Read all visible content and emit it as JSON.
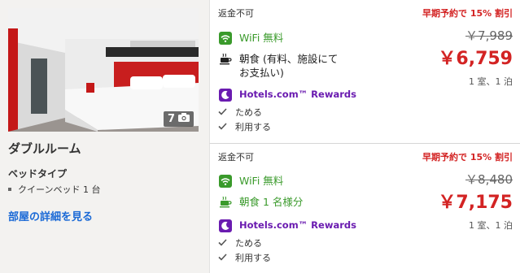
{
  "room": {
    "photo_count": "7",
    "name": "ダブルルーム",
    "bed_type_title": "ベッドタイプ",
    "bed_type_item": "クイーンベッド 1 台",
    "details_link": "部屋の詳細を見る"
  },
  "rates": [
    {
      "refund": "返金不可",
      "wifi": "WiFi 無料",
      "breakfast": "朝食 (有料、施設にて\nお支払い)",
      "rewards": "Hotels.com™ Rewards",
      "rewards_sub1": "ためる",
      "rewards_sub2": "利用する",
      "promo": "早期予約で 15% 割引",
      "original_price": "￥7,989",
      "price": "￥6,759",
      "per": "1 室、1 泊"
    },
    {
      "refund": "返金不可",
      "wifi": "WiFi 無料",
      "breakfast": "朝食 1 名様分",
      "rewards": "Hotels.com™ Rewards",
      "rewards_sub1": "ためる",
      "rewards_sub2": "利用する",
      "promo": "早期予約で 15% 割引",
      "original_price": "￥8,480",
      "price": "￥7,175",
      "per": "1 室、1 泊"
    }
  ],
  "icons": {
    "wifi": "wifi-icon",
    "cup": "cup-icon",
    "moon": "moon-icon",
    "check": "check-icon",
    "camera": "camera-icon"
  },
  "colors": {
    "green": "#3a9a2b",
    "purple": "#6a1bb0",
    "red": "#d32323",
    "link": "#1a69d6"
  }
}
